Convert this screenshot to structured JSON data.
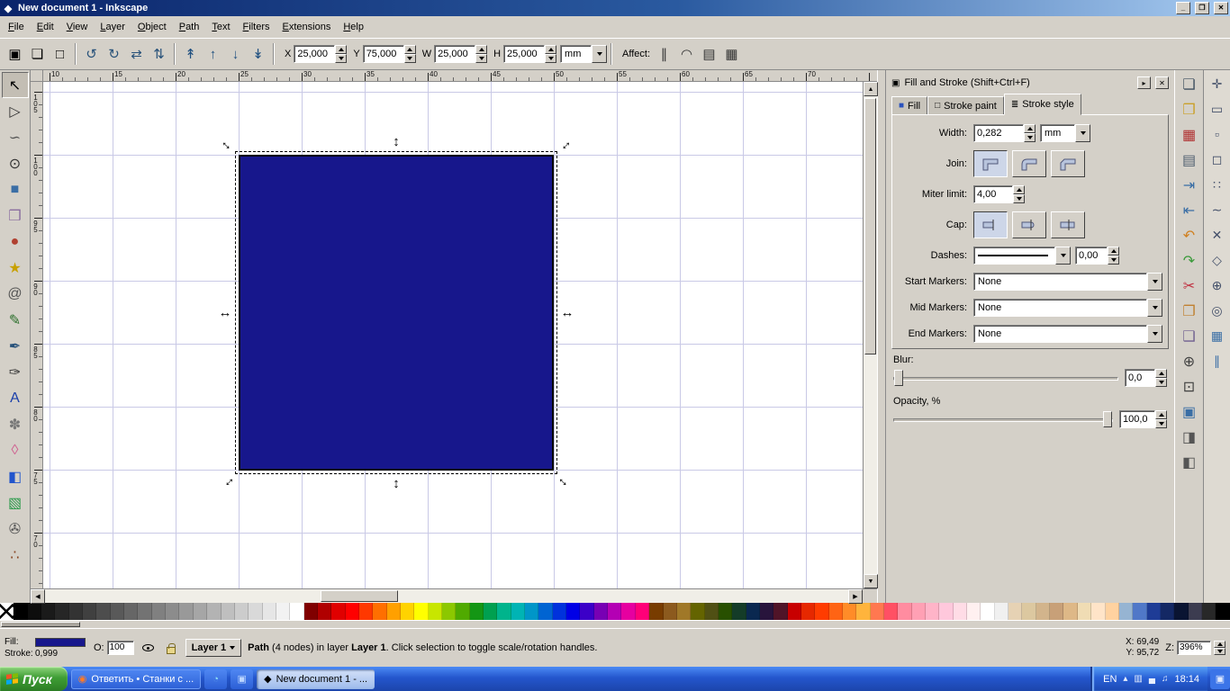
{
  "window": {
    "title": "New document 1 - Inkscape",
    "buttons": {
      "minimize": "_",
      "restore": "❐",
      "close": "✕"
    }
  },
  "menubar": {
    "items": [
      "File",
      "Edit",
      "View",
      "Layer",
      "Object",
      "Path",
      "Text",
      "Filters",
      "Extensions",
      "Help"
    ]
  },
  "toolbar": {
    "select_icons": [
      {
        "name": "select-all-icon",
        "glyph": "▣"
      },
      {
        "name": "select-all-layers-icon",
        "glyph": "❏"
      },
      {
        "name": "deselect-icon",
        "glyph": "□"
      }
    ],
    "transform_icons": [
      {
        "name": "rotate-ccw-icon",
        "glyph": "↺",
        "color": "#28527a"
      },
      {
        "name": "rotate-cw-icon",
        "glyph": "↻",
        "color": "#28527a"
      },
      {
        "name": "flip-horizontal-icon",
        "glyph": "⇄",
        "color": "#28527a"
      },
      {
        "name": "flip-vertical-icon",
        "glyph": "⇅",
        "color": "#28527a"
      }
    ],
    "z_icons": [
      {
        "name": "raise-to-top-icon",
        "glyph": "↟",
        "color": "#205080"
      },
      {
        "name": "raise-icon",
        "glyph": "↑",
        "color": "#205080"
      },
      {
        "name": "lower-icon",
        "glyph": "↓",
        "color": "#205080"
      },
      {
        "name": "lower-to-bottom-icon",
        "glyph": "↡",
        "color": "#205080"
      }
    ],
    "fields": {
      "x_label": "X",
      "x_value": "25,000",
      "y_label": "Y",
      "y_value": "75,000",
      "w_label": "W",
      "w_value": "25,000",
      "h_label": "H",
      "h_value": "25,000",
      "unit": "mm"
    },
    "affect_label": "Affect:",
    "affect_icons": [
      {
        "name": "affect-scale-stroke-icon",
        "glyph": "∥",
        "color": "#333"
      },
      {
        "name": "affect-corners-icon",
        "glyph": "◠",
        "color": "#333"
      },
      {
        "name": "affect-gradient-icon",
        "glyph": "▤",
        "color": "#333"
      },
      {
        "name": "affect-pattern-icon",
        "glyph": "▦",
        "color": "#333"
      }
    ]
  },
  "toolbox": {
    "tools": [
      {
        "name": "selector-tool",
        "glyph": "↖",
        "color": "#000000"
      },
      {
        "name": "node-tool",
        "glyph": "▷",
        "color": "#333333"
      },
      {
        "name": "tweak-tool",
        "glyph": "∽",
        "color": "#555555"
      },
      {
        "name": "zoom-tool",
        "glyph": "⊙",
        "color": "#333333"
      },
      {
        "name": "rectangle-tool",
        "glyph": "■",
        "color": "#3b6ea5"
      },
      {
        "name": "box3d-tool",
        "glyph": "❒",
        "color": "#8a6ea0"
      },
      {
        "name": "ellipse-tool",
        "glyph": "●",
        "color": "#b04030"
      },
      {
        "name": "star-tool",
        "glyph": "★",
        "color": "#c8a000"
      },
      {
        "name": "spiral-tool",
        "glyph": "@",
        "color": "#555555"
      },
      {
        "name": "pencil-tool",
        "glyph": "✎",
        "color": "#2a6e2a"
      },
      {
        "name": "pen-tool",
        "glyph": "✒",
        "color": "#28527a"
      },
      {
        "name": "calligraphy-tool",
        "glyph": "✑",
        "color": "#333333"
      },
      {
        "name": "text-tool",
        "glyph": "A",
        "color": "#1a3faa"
      },
      {
        "name": "spray-tool",
        "glyph": "✽",
        "color": "#777777"
      },
      {
        "name": "eraser-tool",
        "glyph": "◊",
        "color": "#d06090"
      },
      {
        "name": "paint-bucket-tool",
        "glyph": "◧",
        "color": "#2255cc"
      },
      {
        "name": "gradient-tool",
        "glyph": "▧",
        "color": "#2a9a4a"
      },
      {
        "name": "dropper-tool",
        "glyph": "✇",
        "color": "#555555"
      },
      {
        "name": "connector-tool",
        "glyph": "∴",
        "color": "#884422"
      }
    ]
  },
  "rulers": {
    "horizontal": [
      "10",
      "15",
      "20",
      "25",
      "30",
      "35",
      "40",
      "45",
      "50",
      "55",
      "60",
      "65",
      "70"
    ],
    "vertical": [
      "105",
      "100",
      "95",
      "90",
      "85",
      "80",
      "75",
      "70"
    ]
  },
  "canvas": {
    "rect_fill": "#17178c"
  },
  "fill_stroke": {
    "title": "Fill and Stroke (Shift+Ctrl+F)",
    "tabs": [
      {
        "label": "Fill"
      },
      {
        "label": "Stroke paint"
      },
      {
        "label": "Stroke style"
      }
    ],
    "width_label": "Width:",
    "width_value": "0,282",
    "width_unit": "mm",
    "join_label": "Join:",
    "join_options": [
      "miter",
      "round",
      "bevel"
    ],
    "miter_label": "Miter limit:",
    "miter_value": "4,00",
    "cap_label": "Cap:",
    "cap_options": [
      "butt",
      "round",
      "square"
    ],
    "dashes_label": "Dashes:",
    "dashes_offset": "0,00",
    "start_label": "Start Markers:",
    "start_value": "None",
    "mid_label": "Mid Markers:",
    "mid_value": "None",
    "end_label": "End Markers:",
    "end_value": "None",
    "blur_label": "Blur:",
    "blur_value": "0,0",
    "opacity_label": "Opacity, %",
    "opacity_value": "100,0"
  },
  "commandbar": {
    "icons": [
      {
        "name": "new-document-icon",
        "glyph": "❏",
        "color": "#405060"
      },
      {
        "name": "open-document-icon",
        "glyph": "❒",
        "color": "#caa02a"
      },
      {
        "name": "save-document-icon",
        "glyph": "▦",
        "color": "#b03030"
      },
      {
        "name": "print-icon",
        "glyph": "▤",
        "color": "#506070"
      },
      {
        "name": "import-icon",
        "glyph": "⇥",
        "color": "#3a6ea5"
      },
      {
        "name": "export-icon",
        "glyph": "⇤",
        "color": "#3a6ea5"
      },
      {
        "name": "undo-icon",
        "glyph": "↶",
        "color": "#d08020"
      },
      {
        "name": "redo-icon",
        "glyph": "↷",
        "color": "#3a9a3a"
      },
      {
        "name": "cut-icon",
        "glyph": "✂",
        "color": "#c03040"
      },
      {
        "name": "copy-icon",
        "glyph": "❐",
        "color": "#c08030"
      },
      {
        "name": "paste-icon",
        "glyph": "❑",
        "color": "#706090"
      },
      {
        "name": "zoom-drawing-icon",
        "glyph": "⊕",
        "color": "#404040"
      },
      {
        "name": "zoom-page-icon",
        "glyph": "⊡",
        "color": "#404040"
      },
      {
        "name": "duplicate-icon",
        "glyph": "▣",
        "color": "#3a6ea5"
      },
      {
        "name": "clone-icon",
        "glyph": "◨",
        "color": "#555555"
      },
      {
        "name": "unlink-clone-icon",
        "glyph": "◧",
        "color": "#555555"
      }
    ]
  },
  "snapbar": {
    "icons": [
      {
        "name": "snap-enable-icon",
        "glyph": "✛"
      },
      {
        "name": "snap-bbox-icon",
        "glyph": "▭"
      },
      {
        "name": "snap-bbox-edges-icon",
        "glyph": "▫"
      },
      {
        "name": "snap-bbox-corners-icon",
        "glyph": "◻"
      },
      {
        "name": "snap-nodes-icon",
        "glyph": "∷"
      },
      {
        "name": "snap-paths-icon",
        "glyph": "∼"
      },
      {
        "name": "snap-intersections-icon",
        "glyph": "✕"
      },
      {
        "name": "snap-cusp-nodes-icon",
        "glyph": "◇"
      },
      {
        "name": "snap-midpoints-icon",
        "glyph": "⊕"
      },
      {
        "name": "snap-centers-icon",
        "glyph": "◎"
      },
      {
        "name": "snap-grid-icon",
        "glyph": "▦",
        "color": "#3a6ea5"
      },
      {
        "name": "snap-guides-icon",
        "glyph": "∥",
        "color": "#3a6ea5"
      }
    ]
  },
  "palette": {
    "colors": [
      "none",
      "#000000",
      "#0d0d0d",
      "#1a1a1a",
      "#262626",
      "#333333",
      "#404040",
      "#4d4d4d",
      "#595959",
      "#666666",
      "#737373",
      "#808080",
      "#8c8c8c",
      "#999999",
      "#a6a6a6",
      "#b3b3b3",
      "#bfbfbf",
      "#cccccc",
      "#d9d9d9",
      "#e6e6e6",
      "#f2f2f2",
      "#ffffff",
      "#800000",
      "#b00000",
      "#e00000",
      "#ff0000",
      "#ff3800",
      "#ff6f00",
      "#ffa000",
      "#ffd300",
      "#ffff00",
      "#c8e600",
      "#8cc800",
      "#50aa00",
      "#149614",
      "#00a050",
      "#00b48c",
      "#00b4b4",
      "#0096c8",
      "#0064d2",
      "#0032dc",
      "#0000e6",
      "#3c00c8",
      "#7800b4",
      "#b400b4",
      "#e600a0",
      "#ff0078",
      "#783c00",
      "#8c5a1e",
      "#a07828",
      "#646400",
      "#505014",
      "#285000",
      "#143c28",
      "#0a2850",
      "#28143c",
      "#501428",
      "#c80000",
      "#e62800",
      "#ff3c00",
      "#ff6414",
      "#ff8c28",
      "#ffb43c",
      "#ff7850",
      "#ff5064",
      "#ff8ca0",
      "#ffa0b4",
      "#ffb4c8",
      "#ffc8dc",
      "#ffdce6",
      "#fff0f0",
      "#ffffff",
      "#f0f0f0",
      "#e6d2b4",
      "#dcc8a0",
      "#d2b48c",
      "#c8a078",
      "#deb887",
      "#f0dcb4",
      "#ffe4c8",
      "#ffd2a0",
      "#96b4d2",
      "#5078c8",
      "#1e3c96",
      "#142864",
      "#0a1432",
      "#3c3c50",
      "#282828",
      "#000000"
    ]
  },
  "statusbar": {
    "fill_label": "Fill:",
    "stroke_label": "Stroke:",
    "stroke_width": "0,999",
    "opacity_label": "O:",
    "opacity_value": "100",
    "layer_name": "Layer 1",
    "status": {
      "s1": "Path",
      "s2": " (4 nodes) in layer ",
      "s3": "Layer 1",
      "s4": ". Click selection to toggle scale/rotation handles."
    },
    "x_label": "X:",
    "x_value": "69,49",
    "y_label": "Y:",
    "y_value": "95,72",
    "z_label": "Z:",
    "z_value": "396%"
  },
  "taskbar": {
    "start_label": "Пуск",
    "task1_label": "Ответить • Станки с ...",
    "task2_label": "New document 1 - ...",
    "tray": {
      "lang": "EN",
      "time": "18:14"
    }
  }
}
